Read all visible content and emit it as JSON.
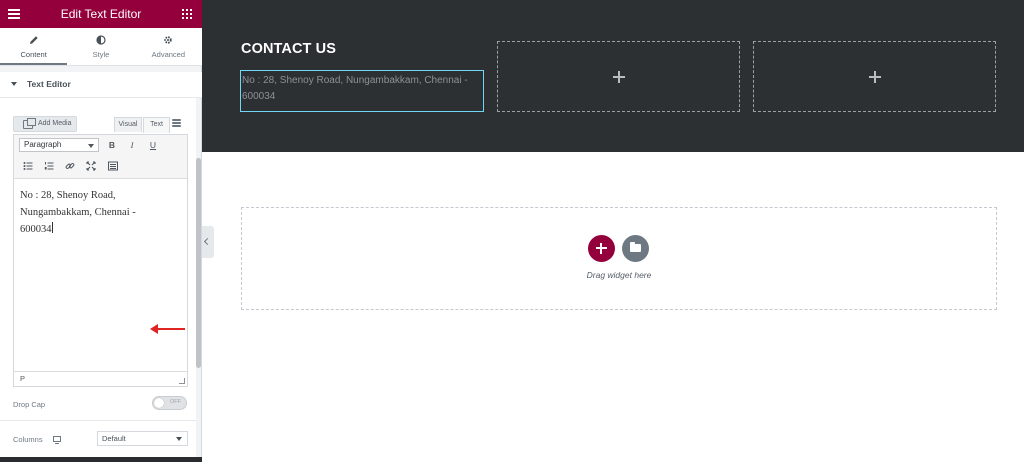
{
  "panel": {
    "title": "Edit Text Editor",
    "tabs": [
      {
        "label": "Content",
        "icon": "pencil-icon"
      },
      {
        "label": "Style",
        "icon": "half-circle-icon"
      },
      {
        "label": "Advanced",
        "icon": "gear-icon"
      }
    ],
    "section_title": "Text Editor",
    "add_media_label": "Add Media",
    "editor_tabs": {
      "visual": "Visual",
      "text": "Text"
    },
    "format_select": "Paragraph",
    "toolbar_buttons": [
      "B",
      "I",
      "U"
    ],
    "content_lines": [
      "No : 28, Shenoy Road,",
      "Nungambakkam, Chennai -",
      "600034"
    ],
    "status_path": "P",
    "drop_cap_label": "Drop Cap",
    "drop_cap_state": "OFF",
    "columns_label": "Columns",
    "columns_value": "Default"
  },
  "canvas": {
    "contact_title": "CONTACT US",
    "address": "No : 28, Shenoy Road,  Nungambakkam, Chennai - 600034",
    "drag_text": "Drag widget here"
  },
  "colors": {
    "brand": "#93003c",
    "dark_section": "#2d3033",
    "selection_outline": "#71d7f7",
    "annotation_arrow": "#e02424"
  }
}
